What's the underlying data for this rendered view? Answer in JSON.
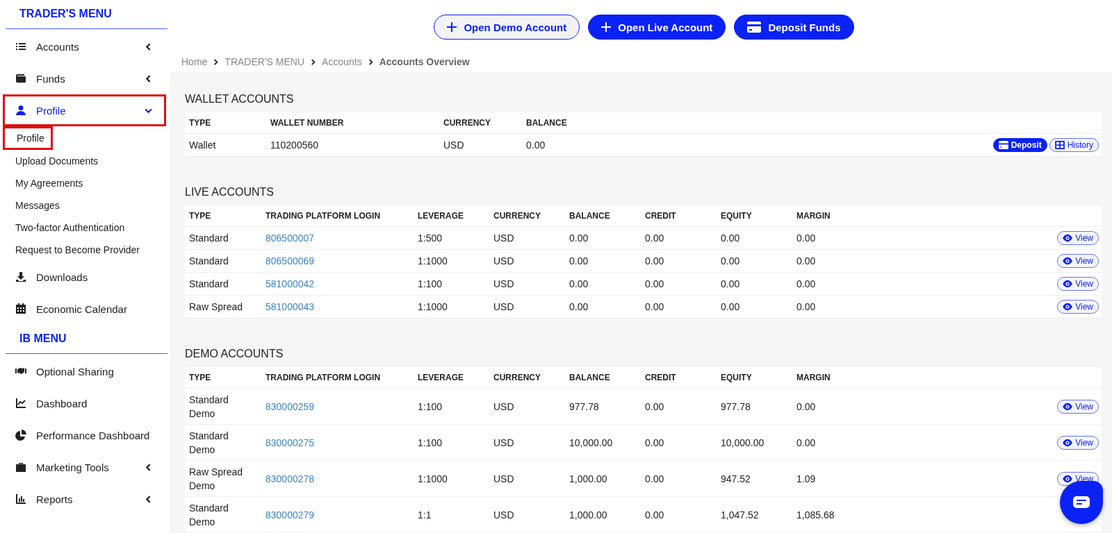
{
  "sidebar": {
    "sections": [
      {
        "title": "TRADER'S MENU",
        "items": [
          {
            "label": "Accounts",
            "kind": "group",
            "expanded": false,
            "selected": false,
            "highlighted": false
          },
          {
            "label": "Funds",
            "kind": "group",
            "expanded": false,
            "selected": false,
            "highlighted": false
          },
          {
            "label": "Profile",
            "kind": "group",
            "expanded": true,
            "selected": true,
            "highlighted": true,
            "children": [
              {
                "label": "Profile",
                "highlighted": true
              },
              {
                "label": "Upload Documents",
                "highlighted": false
              },
              {
                "label": "My Agreements",
                "highlighted": false
              },
              {
                "label": "Messages",
                "highlighted": false
              },
              {
                "label": "Two-factor Authentication",
                "highlighted": false
              },
              {
                "label": "Request to Become Provider",
                "highlighted": false
              }
            ]
          },
          {
            "label": "Downloads",
            "kind": "link",
            "selected": false,
            "highlighted": false
          },
          {
            "label": "Economic Calendar",
            "kind": "link",
            "selected": false,
            "highlighted": false
          }
        ]
      },
      {
        "title": "IB MENU",
        "items": [
          {
            "label": "Optional Sharing",
            "kind": "link",
            "selected": false,
            "highlighted": false
          },
          {
            "label": "Dashboard",
            "kind": "link",
            "selected": false,
            "highlighted": false
          },
          {
            "label": "Performance Dashboard",
            "kind": "link",
            "selected": false,
            "highlighted": false
          },
          {
            "label": "Marketing Tools",
            "kind": "group",
            "expanded": false,
            "selected": false,
            "highlighted": false
          },
          {
            "label": "Reports",
            "kind": "group",
            "expanded": false,
            "selected": false,
            "highlighted": false
          }
        ]
      }
    ]
  },
  "top_buttons": [
    {
      "label": "Open Demo Account",
      "kind": "outline"
    },
    {
      "label": "Open Live Account",
      "kind": "filled"
    },
    {
      "label": "Deposit Funds",
      "kind": "filled"
    }
  ],
  "breadcrumb": [
    "Home",
    "TRADER'S MENU",
    "Accounts",
    "Accounts Overview"
  ],
  "sections": [
    {
      "title": "WALLET ACCOUNTS",
      "columns": [
        {
          "label": "TYPE",
          "kind": "text"
        },
        {
          "label": "WALLET NUMBER",
          "kind": "text"
        },
        {
          "label": "CURRENCY",
          "kind": "text"
        },
        {
          "label": "BALANCE",
          "kind": "text"
        }
      ],
      "rows": [
        {
          "cells": [
            "Wallet",
            "110200560",
            "USD",
            "0.00"
          ],
          "actions": [
            {
              "kind": "deposit",
              "label": "Deposit"
            },
            {
              "kind": "history",
              "label": "History"
            }
          ]
        }
      ]
    },
    {
      "title": "LIVE ACCOUNTS",
      "columns": [
        {
          "label": "TYPE",
          "kind": "text"
        },
        {
          "label": "TRADING PLATFORM LOGIN",
          "kind": "link"
        },
        {
          "label": "LEVERAGE",
          "kind": "text"
        },
        {
          "label": "CURRENCY",
          "kind": "text"
        },
        {
          "label": "BALANCE",
          "kind": "text"
        },
        {
          "label": "CREDIT",
          "kind": "text"
        },
        {
          "label": "EQUITY",
          "kind": "text"
        },
        {
          "label": "MARGIN",
          "kind": "text"
        }
      ],
      "rows": [
        {
          "cells": [
            "Standard",
            "806500007",
            "1:500",
            "USD",
            "0.00",
            "0.00",
            "0.00",
            "0.00"
          ],
          "actions": [
            {
              "kind": "view",
              "label": "View"
            }
          ]
        },
        {
          "cells": [
            "Standard",
            "806500069",
            "1:1000",
            "USD",
            "0.00",
            "0.00",
            "0.00",
            "0.00"
          ],
          "actions": [
            {
              "kind": "view",
              "label": "View"
            }
          ]
        },
        {
          "cells": [
            "Standard",
            "581000042",
            "1:100",
            "USD",
            "0.00",
            "0.00",
            "0.00",
            "0.00"
          ],
          "actions": [
            {
              "kind": "view",
              "label": "View"
            }
          ]
        },
        {
          "cells": [
            "Raw Spread",
            "581000043",
            "1:1000",
            "USD",
            "0.00",
            "0.00",
            "0.00",
            "0.00"
          ],
          "actions": [
            {
              "kind": "view",
              "label": "View"
            }
          ]
        }
      ]
    },
    {
      "title": "DEMO ACCOUNTS",
      "columns": [
        {
          "label": "TYPE",
          "kind": "text"
        },
        {
          "label": "TRADING PLATFORM LOGIN",
          "kind": "link"
        },
        {
          "label": "LEVERAGE",
          "kind": "text"
        },
        {
          "label": "CURRENCY",
          "kind": "text"
        },
        {
          "label": "BALANCE",
          "kind": "text"
        },
        {
          "label": "CREDIT",
          "kind": "text"
        },
        {
          "label": "EQUITY",
          "kind": "text"
        },
        {
          "label": "MARGIN",
          "kind": "text"
        }
      ],
      "rows": [
        {
          "cells": [
            "Standard Demo",
            "830000259",
            "1:100",
            "USD",
            "977.78",
            "0.00",
            "977.78",
            "0.00"
          ],
          "actions": [
            {
              "kind": "view",
              "label": "View"
            }
          ]
        },
        {
          "cells": [
            "Standard Demo",
            "830000275",
            "1:100",
            "USD",
            "10,000.00",
            "0.00",
            "10,000.00",
            "0.00"
          ],
          "actions": [
            {
              "kind": "view",
              "label": "View"
            }
          ]
        },
        {
          "cells": [
            "Raw Spread Demo",
            "830000278",
            "1:1000",
            "USD",
            "1,000.00",
            "0.00",
            "947.52",
            "1.09"
          ],
          "actions": [
            {
              "kind": "view",
              "label": "View"
            }
          ]
        },
        {
          "cells": [
            "Standard Demo",
            "830000279",
            "1:1",
            "USD",
            "1,000.00",
            "0.00",
            "1,047.52",
            "1,085.68"
          ],
          "actions": []
        }
      ]
    }
  ]
}
